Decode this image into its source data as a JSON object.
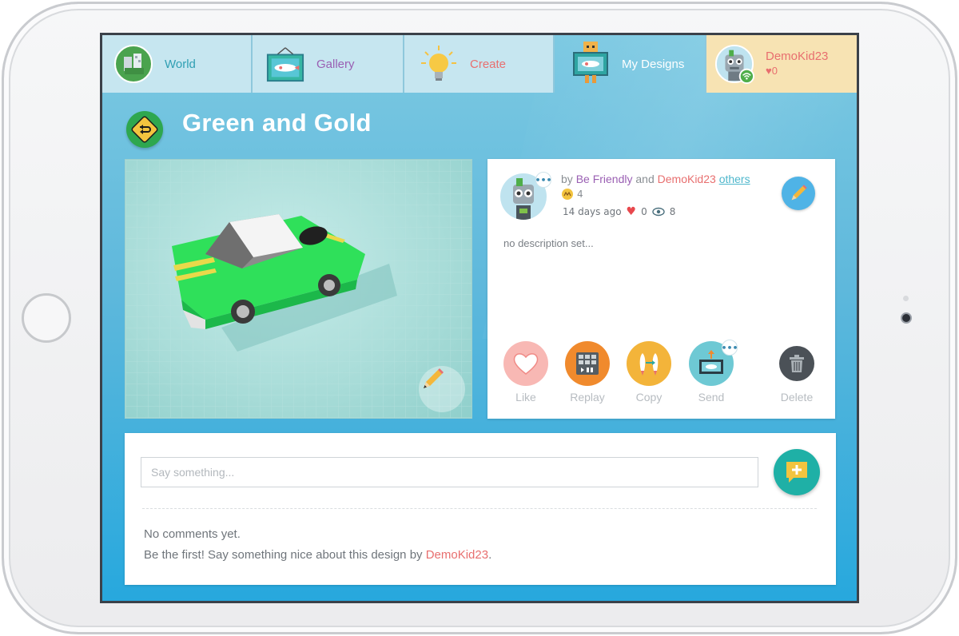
{
  "tabs": {
    "world": "World",
    "gallery": "Gallery",
    "create": "Create",
    "my_designs": "My Designs",
    "user": {
      "name": "DemoKid23",
      "likes": "0"
    }
  },
  "design": {
    "title": "Green and Gold",
    "by_prefix": "by",
    "author_primary": "Be Friendly",
    "and_word": "and",
    "author_secondary": "DemoKid23",
    "others_link": "others",
    "medal_count": "4",
    "age": "14 days ago",
    "likes": "0",
    "views": "8",
    "description": "no description set...",
    "actions": {
      "like": "Like",
      "replay": "Replay",
      "copy": "Copy",
      "send": "Send",
      "delete": "Delete"
    }
  },
  "comments": {
    "placeholder": "Say something...",
    "empty_title": "No comments yet.",
    "empty_prompt": "Be the first! Say something nice about this design by",
    "empty_author": "DemoKid23",
    "period": "."
  },
  "colors": {
    "accent_blue": "#27a8dd",
    "author_purple": "#9a5fb3",
    "author_red": "#e86f6f",
    "send_teal": "#1fb0a6"
  },
  "icons": {
    "world": "world-globe-icon",
    "gallery": "gallery-frame-icon",
    "create": "lightbulb-icon",
    "my_designs": "robot-frame-icon",
    "back": "back-sign-icon",
    "edit": "pencil-icon",
    "like": "heart-icon",
    "replay": "replay-grid-icon",
    "copy": "rocket-copy-icon",
    "send": "send-frame-icon",
    "delete": "trash-icon",
    "comment": "comment-add-icon"
  }
}
